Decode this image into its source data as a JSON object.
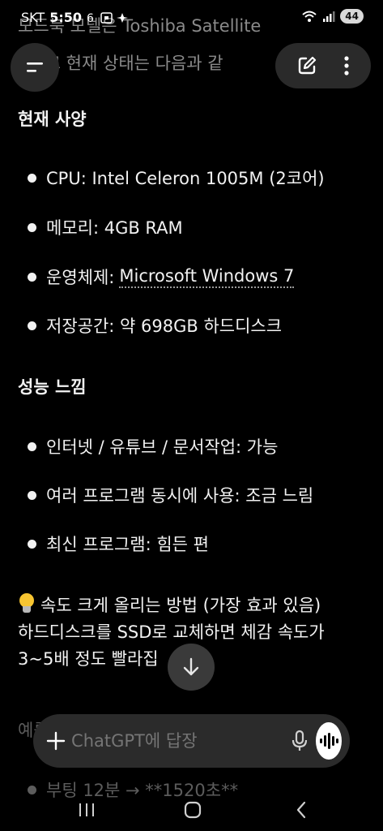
{
  "status_bar": {
    "carrier": "SKT",
    "time": "5:50",
    "battery": "44"
  },
  "ghost_top": {
    "line1": "모드북 모델은 Toshiba Satellite",
    "line2": "A이고 현재 상태는 다음과 같"
  },
  "sections": {
    "specs_heading": "현재 사양",
    "specs": [
      {
        "label": "CPU: Intel Celeron 1005M (2코어)"
      },
      {
        "label": "메모리: 4GB RAM"
      },
      {
        "prefix": "운영체제: ",
        "link": "Microsoft Windows 7"
      },
      {
        "label": "저장공간: 약 698GB 하드디스크"
      }
    ],
    "perf_heading": "성능 느낌",
    "perf": [
      "인터넷 / 유튜브 / 문서작업: 가능",
      "여러 프로그램 동시에 사용: 조금 느림",
      "최신 프로그램: 힘든 편"
    ],
    "tip_line1": "속도 크게 올리는 방법 (가장 효과 있음)",
    "tip_line2": "하드디스크를 SSD로 교체하면 체감 속도가",
    "tip_line3": "3~5배 정도 빨라집",
    "faded_heading": "예를",
    "faded_bullet": "부팅 12분 → **1520초**"
  },
  "composer": {
    "placeholder": "ChatGPT에 답장"
  },
  "icons": {
    "menu": "menu-icon",
    "edit": "edit-icon",
    "more": "more-vertical-icon",
    "scroll": "arrow-down-icon",
    "plus": "plus-icon",
    "mic": "mic-icon",
    "voice": "voice-mode-icon"
  }
}
